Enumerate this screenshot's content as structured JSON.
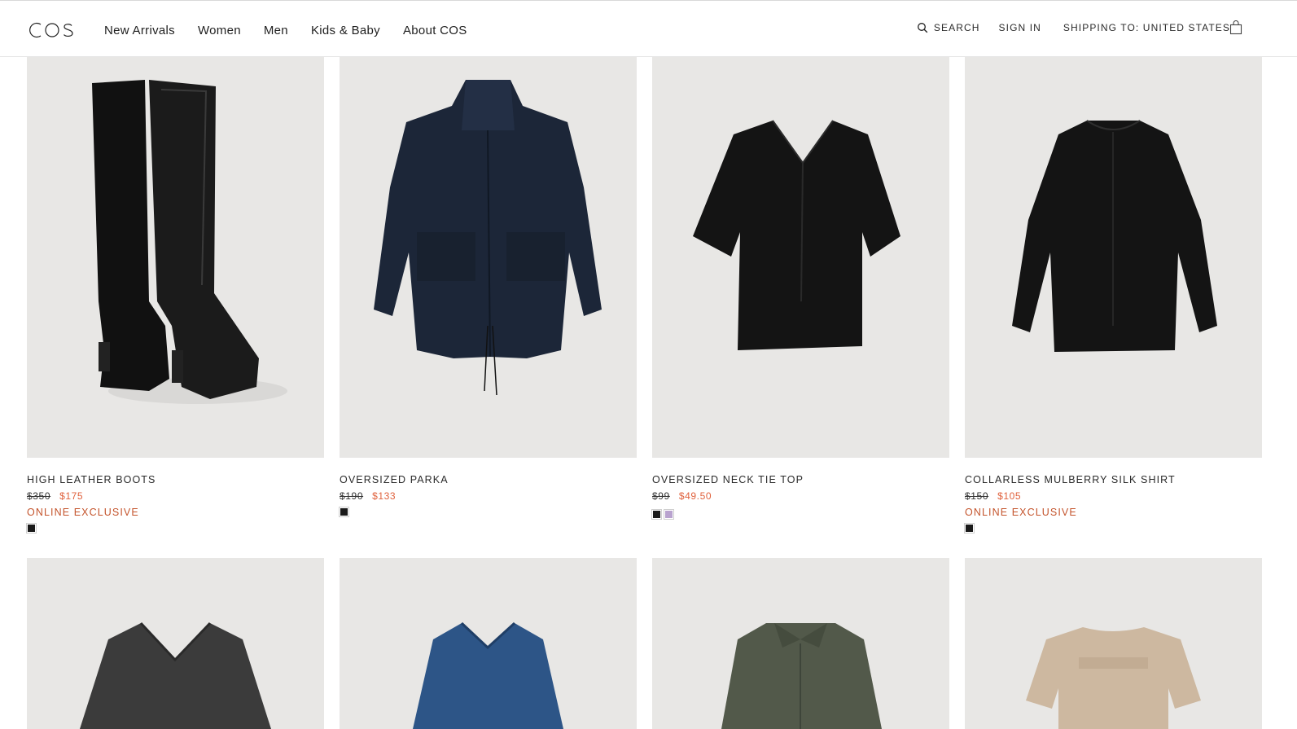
{
  "header": {
    "logo_text": "COS",
    "nav": [
      "New Arrivals",
      "Women",
      "Men",
      "Kids & Baby",
      "About COS"
    ],
    "search_label": "SEARCH",
    "signin_label": "SIGN IN",
    "shipping_label": "SHIPPING TO: UNITED STATES",
    "bag_icon": "shopping-bag-icon"
  },
  "colors": {
    "sale": "#e0613c",
    "exclusive": "#c4542c",
    "image_bg": "#e8e7e5"
  },
  "products": [
    {
      "name": "HIGH LEATHER BOOTS",
      "old_price": "$350",
      "price": "$175",
      "badge": "ONLINE EXCLUSIVE",
      "swatches": [
        "#1a1a1a"
      ]
    },
    {
      "name": "OVERSIZED PARKA",
      "old_price": "$190",
      "price": "$133",
      "badge": "",
      "swatches": [
        "#1a1a1a"
      ]
    },
    {
      "name": "OVERSIZED NECK TIE TOP",
      "old_price": "$99",
      "price": "$49.50",
      "badge": "",
      "swatches": [
        "#1a1a1a",
        "#b9a3cf"
      ]
    },
    {
      "name": "COLLARLESS MULBERRY SILK SHIRT",
      "old_price": "$150",
      "price": "$105",
      "badge": "ONLINE EXCLUSIVE",
      "swatches": [
        "#1a1a1a"
      ]
    }
  ]
}
